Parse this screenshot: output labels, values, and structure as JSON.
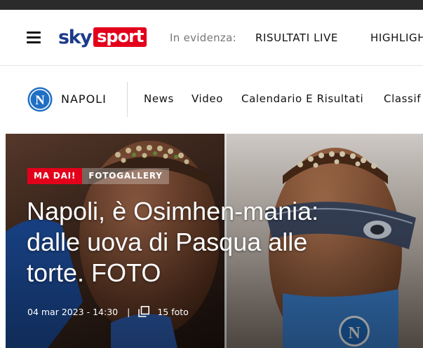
{
  "header": {
    "logo_sky": "sky",
    "logo_sport": "sport",
    "evidenza_label": "In evidenza:",
    "links": [
      "RISULTATI LIVE",
      "HIGHLIGH"
    ]
  },
  "subnav": {
    "team": "NAPOLI",
    "links": [
      "News",
      "Video",
      "Calendario E Risultati",
      "Classif"
    ]
  },
  "hero": {
    "badges": [
      "MA DAI!",
      "FOTOGALLERY"
    ],
    "title": "Napoli, è Osimhen-mania: dalle uova di Pasqua alle torte. FOTO",
    "date": "04 mar 2023 - 14:30",
    "separator": "|",
    "photo_count": "15 foto"
  },
  "colors": {
    "brand_red": "#e3001b",
    "sky_blue": "#1b3a8a",
    "napoli_blue": "#1f6fc4"
  }
}
